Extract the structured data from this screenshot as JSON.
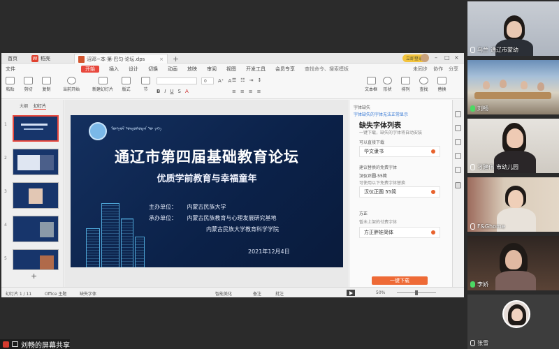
{
  "titlebar": {
    "home_tab": "首页",
    "app_tab": "稻壳",
    "file_tab": "沼邓~本·第·巴匀·论坛.dps",
    "new_tab": "+",
    "login_badge": "立即登录"
  },
  "menu": {
    "items": [
      "文件",
      "开始",
      "插入",
      "设计",
      "切换",
      "动画",
      "放映",
      "审阅",
      "视图",
      "开发工具",
      "会员专享"
    ],
    "active_index": 1,
    "search": "查找命令、搜索模板",
    "right": [
      "未同步",
      "协作",
      "分享"
    ]
  },
  "ribbon": {
    "big_buttons": [
      "当前开始",
      "新建幻灯片",
      "版式",
      "节"
    ],
    "small_left": [
      "格式刷",
      "粘贴",
      "剪切",
      "复制"
    ],
    "font_size": "0",
    "right_buttons": [
      "文本框",
      "形状",
      "排列",
      "查找",
      "替换"
    ]
  },
  "thumbnails": {
    "tabs": [
      "大纲",
      "幻灯片"
    ],
    "numbers": [
      "1",
      "2",
      "3",
      "4",
      "5"
    ],
    "add": "+"
  },
  "slide": {
    "title": "通辽市第四届基础教育论坛",
    "subtitle": "优质学前教育与幸福童年",
    "university_name": "ᠮᠣᠩᠭᠣᠯ ᠤᠨᠳᠤᠰᠤᠲᠡᠨ ᠦ ᠶᠡᠬᠡ",
    "host_label": "主办单位：",
    "host_value": "内蒙古民族大学",
    "organizer_label": "承办单位：",
    "organizer_value_1": "内蒙古民族教育与心理发展研究基地",
    "organizer_value_2": "内蒙古民族大学教育科学学院",
    "date": "2021年12月4日"
  },
  "taskpane": {
    "top": "字体缺失",
    "link": "字体缺失的字体无法正常显示",
    "heading": "缺失字体列表",
    "note": "一键下载，缺失的字体将自动安装",
    "group1": "可以直接下载",
    "font1": "华文隶书",
    "group2": "建议替换的免费字体",
    "group2_label": "汉仪正圆-55简",
    "group2_hint": "可使用以下免费字体替换",
    "font2": "汉仪正圆 55简",
    "group3": "方正",
    "group3_hint": "暂未上架的付费字体",
    "font3": "方正胖娃简体",
    "download": "一键下载"
  },
  "statusbar": {
    "slide_count": "幻灯片 1 / 11",
    "theme": "Office 主题",
    "missing_font": "缺失字体",
    "smart_beautify": "智能美化",
    "notes": "备注",
    "comment": "批注",
    "zoom": "50%"
  },
  "participants": [
    {
      "name": "乌兰",
      "sub": "通辽市蒙幼",
      "mic": "off"
    },
    {
      "name": "刘畅",
      "sub": "",
      "mic": "on"
    },
    {
      "name": "刁建伟",
      "sub": "市幼儿园",
      "mic": "off"
    },
    {
      "name": "F&Ghome",
      "sub": "",
      "mic": "off"
    },
    {
      "name": "李娇",
      "sub": "",
      "mic": "on"
    },
    {
      "name": "张雪",
      "sub": "",
      "mic": "off"
    }
  ],
  "share": {
    "label": "刘畅的屏幕共享"
  },
  "colors": {
    "slide_bg": "#14305f",
    "accent_red": "#e8483d",
    "download_orange": "#ee6a36"
  }
}
